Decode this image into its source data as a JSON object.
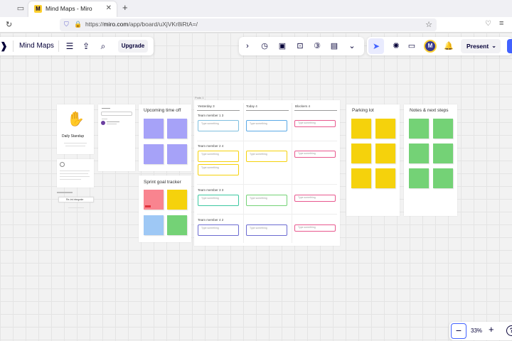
{
  "browser": {
    "tab_title": "Mind Maps - Miro",
    "url_prefix": "https://",
    "url_host": "miro.com",
    "url_path": "/app/board/uXjVKr8iRtA=/"
  },
  "toolbar": {
    "board_name": "Mind Maps",
    "upgrade_label": "Upgrade",
    "present_label": "Present",
    "avatar_initial": "M"
  },
  "zoom": {
    "level": "33%"
  },
  "board": {
    "standup": {
      "title": "Daily Standup",
      "card_label": "Re-Int Integrate"
    },
    "upcoming": {
      "title": "Upcoming time off"
    },
    "sprint": {
      "title": "Sprint goal tracker"
    },
    "parking": {
      "title": "Parking lot"
    },
    "notes": {
      "title": "Notes & next steps"
    },
    "pods_label": "Pods 1",
    "columns": {
      "yesterday": "Yesterday  3",
      "today": "Today  4",
      "blockers": "Blockers  4"
    },
    "members": [
      "Team member 1  3",
      "Team member 2  4",
      "Team member 3  3",
      "Team member 4  2"
    ],
    "card_placeholder": "Type something"
  },
  "colors": {
    "accent": "#4262ff",
    "brand_yellow": "#ffd02f"
  }
}
